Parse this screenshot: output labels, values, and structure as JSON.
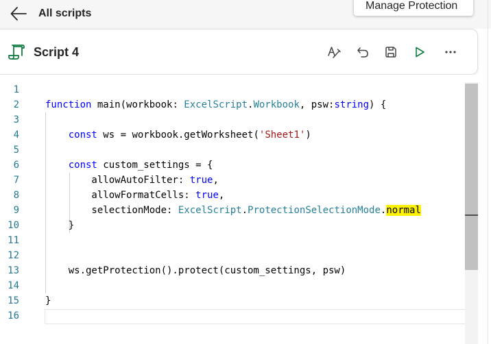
{
  "nav": {
    "back_label": "All scripts"
  },
  "tooltip": {
    "text": "Manage Protection"
  },
  "script": {
    "title": "Script 4"
  },
  "toolbar": [
    {
      "name": "format-code-icon"
    },
    {
      "name": "undo-icon"
    },
    {
      "name": "save-icon"
    },
    {
      "name": "run-icon"
    },
    {
      "name": "more-options-icon"
    }
  ],
  "editor": {
    "line_numbers": [
      "1",
      "2",
      "3",
      "4",
      "5",
      "6",
      "7",
      "8",
      "9",
      "10",
      "11",
      "12",
      "13",
      "14",
      "15",
      "16"
    ],
    "lines": [
      "",
      "function main(workbook: ExcelScript.Workbook, psw:string) {",
      "",
      "    const ws = workbook.getWorksheet('Sheet1')",
      "",
      "    const custom_settings = {",
      "        allowAutoFilter: true,",
      "        allowFormatCells: true,",
      "        selectionMode: ExcelScript.ProtectionSelectionMode.normal",
      "    }",
      "",
      "",
      "    ws.getProtection().protect(custom_settings, psw)",
      "",
      "}",
      ""
    ]
  },
  "colors": {
    "keyword": "#0000ff",
    "type": "#267f99",
    "string": "#a31515",
    "line_number": "#237893",
    "highlight": "#fff200",
    "accent": "#107c41"
  }
}
